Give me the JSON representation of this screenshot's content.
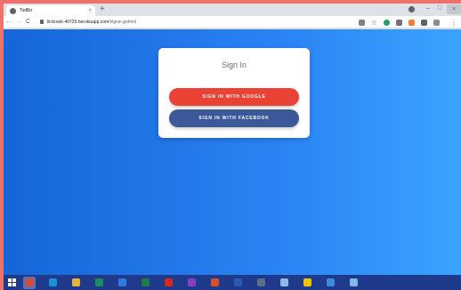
{
  "browser": {
    "tab": {
      "title": "TodBo",
      "favicon": "globe-icon",
      "close_glyph": "×"
    },
    "new_tab_glyph": "+",
    "window_controls": {
      "minimize": "–",
      "maximize": "□",
      "close": "×"
    },
    "nav": {
      "back": "←",
      "forward": "→",
      "reload": "C"
    },
    "url": {
      "host": "lit-brook-40726.herokuapp.com",
      "path": "/signin.gohtml"
    },
    "toolbar_icons": [
      "translate-icon",
      "star-icon",
      "grammarly-icon",
      "extension-icon",
      "orange-extension-icon",
      "puzzle-icon",
      "reading-list-icon",
      "kebab-menu-icon"
    ],
    "star_glyph": "☆",
    "menu_glyph": "⋮"
  },
  "page": {
    "background": {
      "from": "#1565d8",
      "to": "#3aa4ff"
    },
    "card": {
      "title": "Sign In",
      "google_button": {
        "label": "SIGN IN WITH GOOGLE",
        "color": "#ea4335"
      },
      "facebook_button": {
        "label": "SIGN IN WITH FACEBOOK",
        "color": "#3b5998"
      }
    }
  },
  "taskbar": {
    "background": "#1f3a8a",
    "apps": [
      "chrome-icon",
      "edge-icon",
      "file-explorer-icon",
      "store-icon",
      "vscode-icon",
      "excel-icon",
      "acrobat-icon",
      "onenote-icon",
      "powerpoint-icon",
      "word-icon",
      "snipping-icon",
      "notepad-icon",
      "chat-icon",
      "calendar-icon",
      "photos-icon"
    ],
    "app_colors": [
      "#d9473b",
      "#1a8fd8",
      "#e8b33b",
      "#1d8f5e",
      "#2d7be0",
      "#1f7a45",
      "#d32a1e",
      "#8a3dc1",
      "#d6502e",
      "#2a5ab8",
      "#5d6e8a",
      "#8fb9e8",
      "#f2c200",
      "#3b8ce0",
      "#7fb7e8"
    ]
  }
}
